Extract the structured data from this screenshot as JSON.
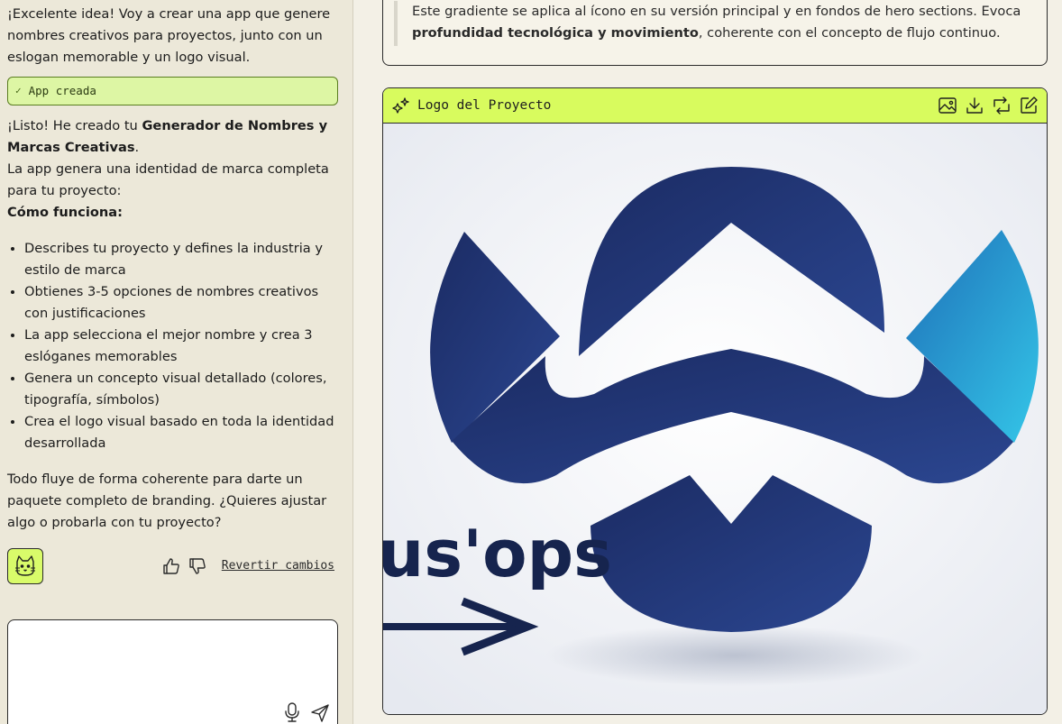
{
  "chat": {
    "intro": "¡Excelente idea! Voy a crear una app que genere nombres creativos para proyectos, junto con un eslogan memorable y un logo visual.",
    "status_label": "App creada",
    "done_prefix": "¡Listo! He creado tu ",
    "done_bold": "Generador de Nombres y Marcas Creativas",
    "done_suffix": ".",
    "summary": "La app genera una identidad de marca completa para tu proyecto:",
    "how_heading": "Cómo funciona:",
    "features": [
      "Describes tu proyecto y defines la industria y estilo de marca",
      "Obtienes 3-5 opciones de nombres creativos con justificaciones",
      "La app selecciona el mejor nombre y crea 3 eslóganes memorables",
      "Genera un concepto visual detallado (colores, tipografía, símbolos)",
      "Crea el logo visual basado en toda la identidad desarrollada"
    ],
    "closing": "Todo fluye de forma coherente para darte un paquete completo de branding. ¿Quieres ajustar algo o probarla con tu proyecto?",
    "revert_label": "Revertir cambios",
    "composer_placeholder": ""
  },
  "main": {
    "gradient_text_1": "Este gradiente se aplica al ícono en su versión principal y en fondos de hero sections. Evoca ",
    "gradient_bold": "profundidad tecnológica y movimiento",
    "gradient_text_2": ", coherente con el concepto de flujo continuo.",
    "logo_card_title": "Logo del Proyecto",
    "logo_wordmark": "us'ops"
  },
  "icons": {
    "status": "check-icon",
    "avatar": "cat-icon",
    "like": "thumbs-up-icon",
    "dislike": "thumbs-down-icon",
    "mic": "microphone-icon",
    "send": "send-icon",
    "sparkle": "sparkle-icon",
    "image": "image-icon",
    "download": "download-icon",
    "regenerate": "regenerate-icon",
    "edit": "edit-icon"
  },
  "colors": {
    "accent_lime": "#d8fb5e",
    "status_green": "#ddf6a4",
    "logo_navy": "#1f3575",
    "logo_cyan": "#34c6e8",
    "chat_bg": "#ece8d9",
    "main_bg": "#f3f0e6"
  }
}
